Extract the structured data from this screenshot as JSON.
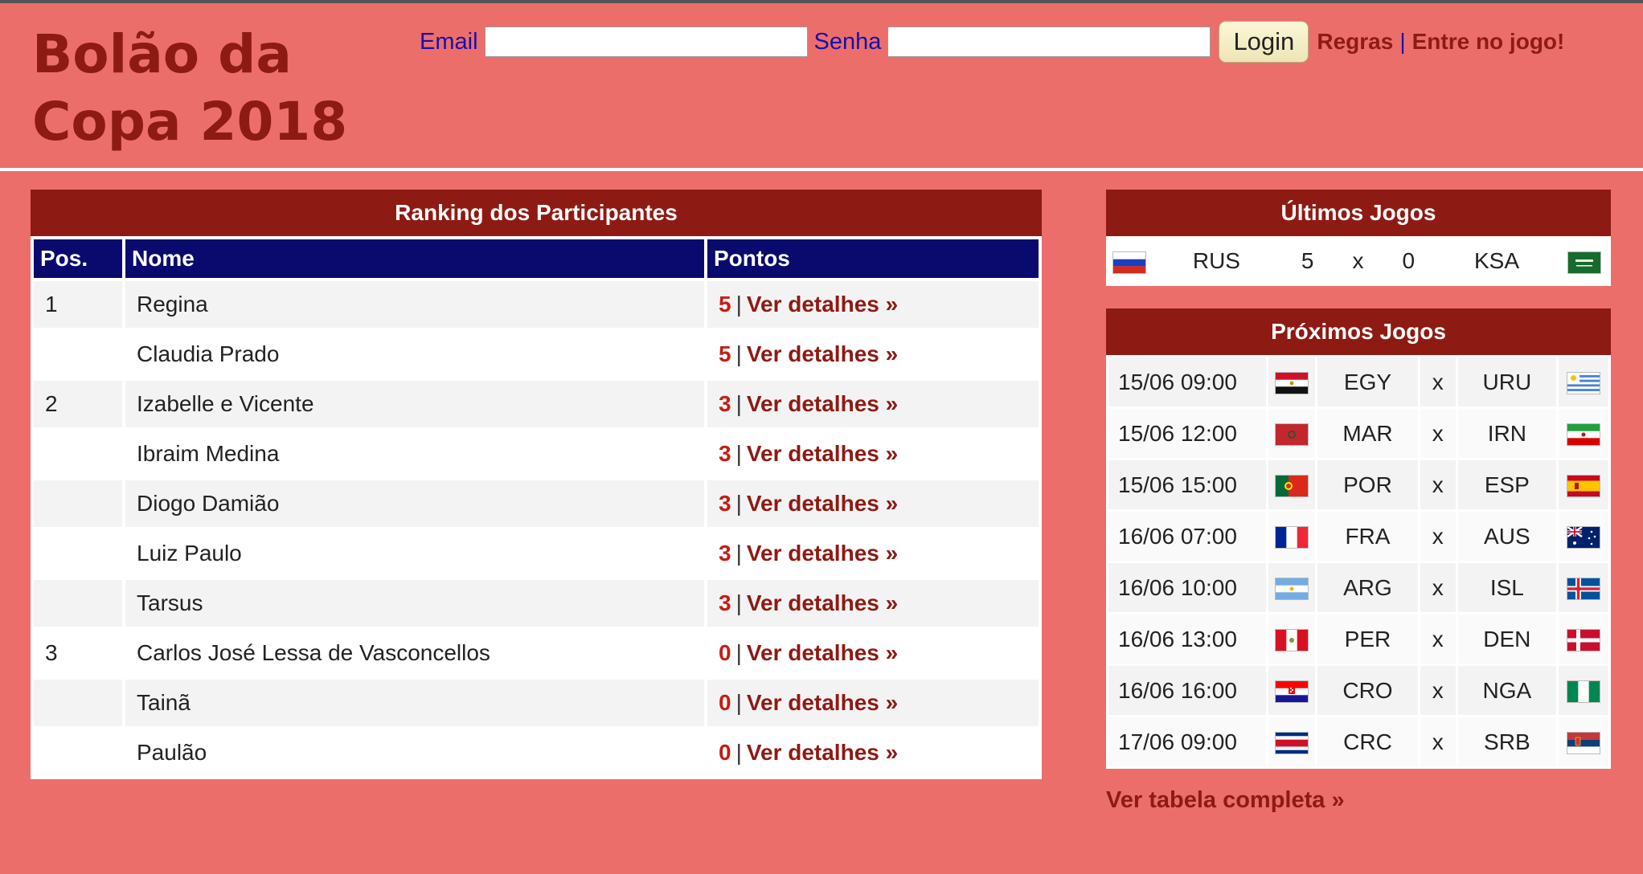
{
  "header": {
    "title_line1": "Bolão da",
    "title_line2": "Copa 2018",
    "email_label": "Email",
    "password_label": "Senha",
    "login_button": "Login",
    "rules_link": "Regras",
    "separator": "|",
    "join_link": "Entre no jogo!"
  },
  "ranking": {
    "title": "Ranking dos Participantes",
    "columns": [
      "Pos.",
      "Nome",
      "Pontos"
    ],
    "details_label": "Ver detalhes »",
    "rows": [
      {
        "pos": "1",
        "name": "Regina",
        "points": "5"
      },
      {
        "pos": "",
        "name": "Claudia Prado",
        "points": "5"
      },
      {
        "pos": "2",
        "name": "Izabelle e Vicente",
        "points": "3"
      },
      {
        "pos": "",
        "name": "Ibraim Medina",
        "points": "3"
      },
      {
        "pos": "",
        "name": "Diogo Damião",
        "points": "3"
      },
      {
        "pos": "",
        "name": "Luiz Paulo",
        "points": "3"
      },
      {
        "pos": "",
        "name": "Tarsus",
        "points": "3"
      },
      {
        "pos": "3",
        "name": "Carlos José Lessa de Vasconcellos",
        "points": "0"
      },
      {
        "pos": "",
        "name": "Tainã",
        "points": "0"
      },
      {
        "pos": "",
        "name": "Paulão",
        "points": "0"
      }
    ]
  },
  "last_games": {
    "title": "Últimos Jogos",
    "games": [
      {
        "home": "RUS",
        "home_flag": "flag-russia-icon",
        "home_score": "5",
        "vs": "x",
        "away_score": "0",
        "away": "KSA",
        "away_flag": "flag-saudi-arabia-icon"
      }
    ]
  },
  "next_games": {
    "title": "Próximos Jogos",
    "games": [
      {
        "date": "15/06 09:00",
        "home": "EGY",
        "home_flag": "flag-egypt-icon",
        "vs": "x",
        "away": "URU",
        "away_flag": "flag-uruguay-icon"
      },
      {
        "date": "15/06 12:00",
        "home": "MAR",
        "home_flag": "flag-morocco-icon",
        "vs": "x",
        "away": "IRN",
        "away_flag": "flag-iran-icon"
      },
      {
        "date": "15/06 15:00",
        "home": "POR",
        "home_flag": "flag-portugal-icon",
        "vs": "x",
        "away": "ESP",
        "away_flag": "flag-spain-icon"
      },
      {
        "date": "16/06 07:00",
        "home": "FRA",
        "home_flag": "flag-france-icon",
        "vs": "x",
        "away": "AUS",
        "away_flag": "flag-australia-icon"
      },
      {
        "date": "16/06 10:00",
        "home": "ARG",
        "home_flag": "flag-argentina-icon",
        "vs": "x",
        "away": "ISL",
        "away_flag": "flag-iceland-icon"
      },
      {
        "date": "16/06 13:00",
        "home": "PER",
        "home_flag": "flag-peru-icon",
        "vs": "x",
        "away": "DEN",
        "away_flag": "flag-denmark-icon"
      },
      {
        "date": "16/06 16:00",
        "home": "CRO",
        "home_flag": "flag-croatia-icon",
        "vs": "x",
        "away": "NGA",
        "away_flag": "flag-nigeria-icon"
      },
      {
        "date": "17/06 09:00",
        "home": "CRC",
        "home_flag": "flag-costa-rica-icon",
        "vs": "x",
        "away": "SRB",
        "away_flag": "flag-serbia-icon"
      }
    ]
  },
  "footer_link": "Ver tabela completa »",
  "colors": {
    "background": "#ec6e6b",
    "brand_dark_red": "#8e1a14",
    "header_navy": "#0a0a6e",
    "points_red": "#c41e14",
    "label_blue": "#1a10a8"
  }
}
